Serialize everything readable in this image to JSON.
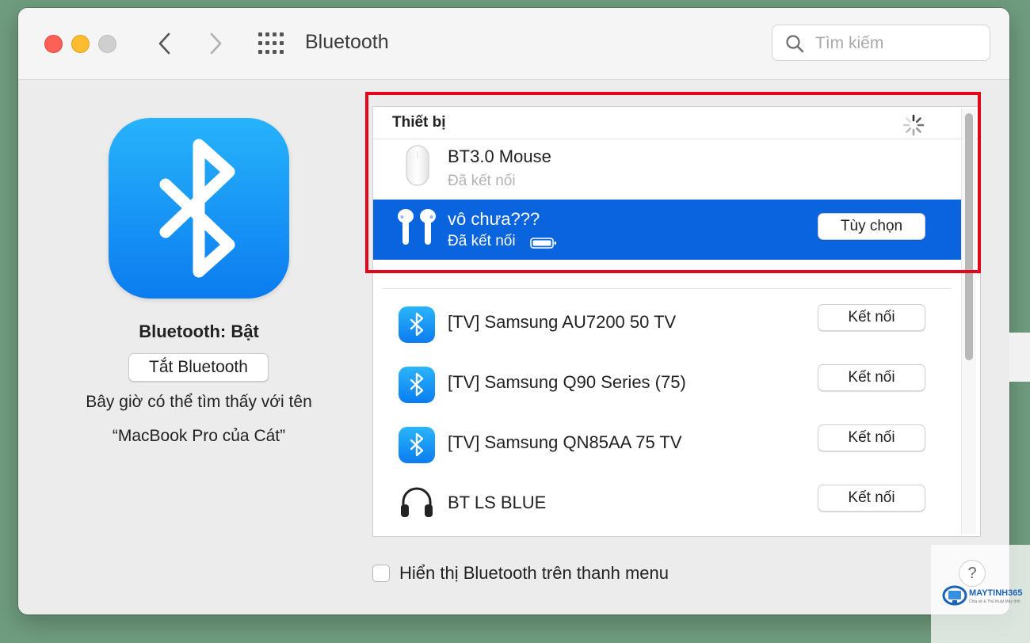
{
  "window": {
    "title": "Bluetooth"
  },
  "search": {
    "placeholder": "Tìm kiếm",
    "value": ""
  },
  "left_panel": {
    "status": "Bluetooth: Bật",
    "turn_off_label": "Tắt Bluetooth",
    "discoverable_line1": "Bây giờ có thể tìm thấy với tên",
    "discoverable_line2": "“MacBook Pro của Cát”"
  },
  "devices": {
    "header": "Thiết bị",
    "connected": [
      {
        "name": "BT3.0 Mouse",
        "status": "Đã kết nối",
        "icon": "mouse-icon",
        "selected": false
      },
      {
        "name": "vô chưa???",
        "status": "Đã kết nối",
        "icon": "airpods-icon",
        "selected": true,
        "button": "Tùy chọn",
        "battery": "full"
      }
    ],
    "available": [
      {
        "name": "[TV] Samsung AU7200 50 TV",
        "icon": "bluetooth-icon",
        "button": "Kết nối"
      },
      {
        "name": "[TV] Samsung Q90 Series (75)",
        "icon": "bluetooth-icon",
        "button": "Kết nối"
      },
      {
        "name": "[TV] Samsung QN85AA 75 TV",
        "icon": "bluetooth-icon",
        "button": "Kết nối"
      },
      {
        "name": "BT LS BLUE",
        "icon": "headphones-icon",
        "button": "Kết nối"
      }
    ]
  },
  "menu_option": {
    "label": "Hiển thị Bluetooth trên thanh menu",
    "checked": false
  },
  "help": {
    "symbol": "?"
  },
  "watermark": {
    "brand": "MAYTINH365",
    "tagline": "Chia sẻ & Thủ thuật Máy tính"
  },
  "colors": {
    "selection": "#0a64de",
    "highlight_border": "#e3061b",
    "bluetooth_gradient_top": "#27b3fb",
    "bluetooth_gradient_bottom": "#0b7cf0"
  }
}
